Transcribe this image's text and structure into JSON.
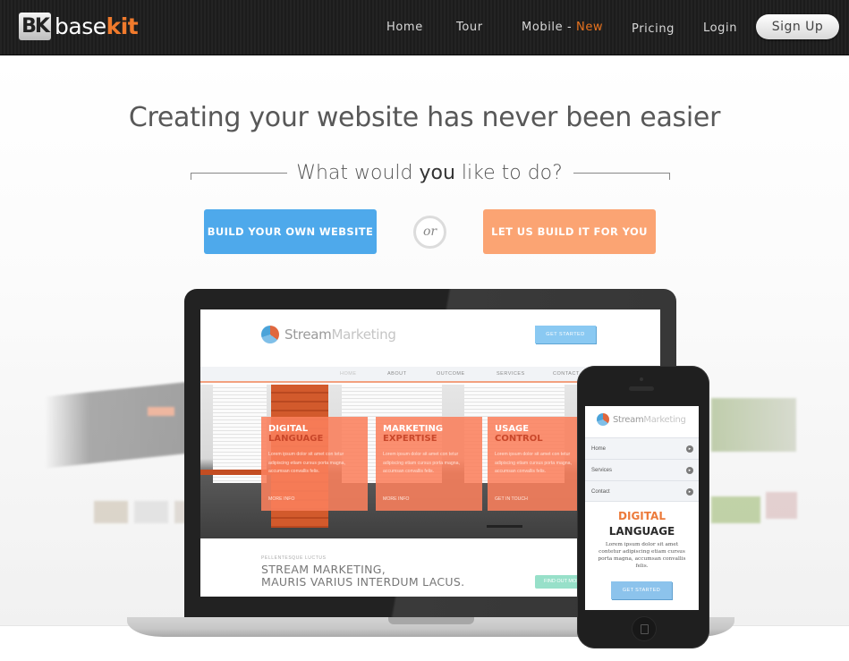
{
  "header": {
    "logo": {
      "mark": "BK",
      "text_base": "base",
      "text_kit": "kit"
    },
    "nav": [
      {
        "label": "Home"
      },
      {
        "label": "Tour"
      },
      {
        "label": "Mobile - ",
        "badge": "New"
      },
      {
        "label": "Pricing"
      },
      {
        "label": "Login"
      }
    ],
    "signup_label": "Sign Up"
  },
  "hero": {
    "headline": "Creating your website has never been easier",
    "subhead_pre": "What would ",
    "subhead_bold": "you",
    "subhead_post": " like to do?",
    "build_button": "BUILD YOUR OWN WEBSITE",
    "or_label": "or",
    "let_us_button": "LET US BUILD IT FOR YOU"
  },
  "colors": {
    "accent_orange": "#e8731f",
    "build_blue": "#4ea9eb",
    "let_us_orange": "#fba473"
  },
  "laptop_preview": {
    "brand_stream": "Stream",
    "brand_marketing": "Marketing",
    "get_started": "GET STARTED",
    "nav": [
      "HOME",
      "ABOUT",
      "OUTCOME",
      "SERVICES",
      "CONTACT"
    ],
    "cards": [
      {
        "line1": "DIGITAL",
        "line2": "LANGUAGE",
        "body": "Lorem ipsum dolor sit amet con tetur adipiscing etiam cursus porta magna, accumsan convallis felis.",
        "link": "MORE INFO"
      },
      {
        "line1": "MARKETING",
        "line2": "EXPERTISE",
        "body": "Lorem ipsum dolor sit amet con tetur adipiscing etiam cursus porta magna, accumsan convallis felis.",
        "link": "MORE INFO"
      },
      {
        "line1": "USAGE",
        "line2": "CONTROL",
        "body": "Lorem ipsum dolor sit amet con tetur adipiscing etiam cursus porta magna, accumsan convallis felis.",
        "link": "GET IN TOUCH"
      }
    ],
    "pre_title": "PELLENTESQUE LUCTUS",
    "title_line1": "STREAM MARKETING,",
    "title_line2": "MAURIS VARIUS INTERDUM LACUS.",
    "find_out": "FIND OUT MORE"
  },
  "phone_preview": {
    "brand_stream": "Stream",
    "brand_marketing": "Marketing",
    "menu": [
      {
        "label": "Home"
      },
      {
        "label": "Services"
      },
      {
        "label": "Contact"
      }
    ],
    "title1": "DIGITAL",
    "title2": "LANGUAGE",
    "body": "Lorem ipsum dolor sit amet contetur adipiscing etiam cursus porta magna, accumsan convallis felis.",
    "get_started": "GET STARTED"
  }
}
